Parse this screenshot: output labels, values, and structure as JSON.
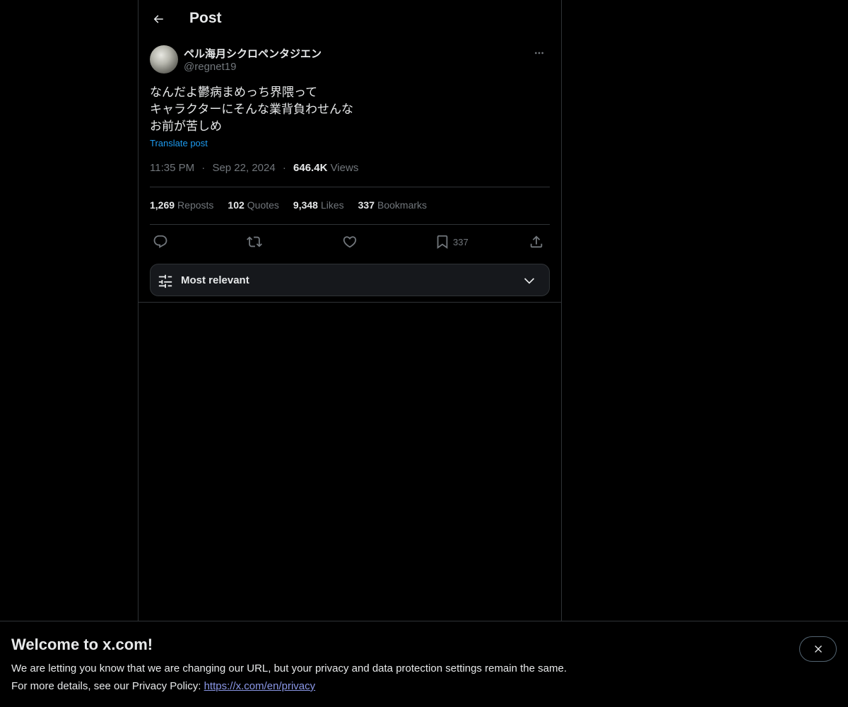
{
  "topbar": {
    "title": "Post"
  },
  "post": {
    "author": {
      "display_name": "ペル海月シクロペンタジエン",
      "handle": "@regnet19"
    },
    "text_lines": [
      "なんだよ鬱病まめっち界隈って",
      "キャラクターにそんな業背負わせんな",
      "お前が苦しめ"
    ],
    "translate_label": "Translate post",
    "time": "11:35 PM",
    "date": "Sep 22, 2024",
    "views_count": "646.4K",
    "views_label": "Views",
    "separator": "·"
  },
  "stats": {
    "reposts": {
      "count": "1,269",
      "label": "Reposts"
    },
    "quotes": {
      "count": "102",
      "label": "Quotes"
    },
    "likes": {
      "count": "9,348",
      "label": "Likes"
    },
    "bookmarks": {
      "count": "337",
      "label": "Bookmarks"
    }
  },
  "actions": {
    "bookmark_count": "337"
  },
  "sort": {
    "label": "Most relevant"
  },
  "banner": {
    "title": "Welcome to x.com!",
    "line1": "We are letting you know that we are changing our URL, but your privacy and data protection settings remain the same.",
    "line2_prefix": "For more details, see our Privacy Policy: ",
    "link": "https://x.com/en/privacy"
  },
  "colors": {
    "background": "#000000",
    "text_primary": "#e7e9ea",
    "text_secondary": "#71767b",
    "accent": "#1d9bf0",
    "border": "#2f3336",
    "link": "#8b98e8"
  },
  "icons": [
    "back-arrow-icon",
    "more-icon",
    "reply-icon",
    "repost-icon",
    "like-icon",
    "bookmark-icon",
    "share-icon",
    "filter-icon",
    "chevron-down-icon",
    "close-icon"
  ]
}
